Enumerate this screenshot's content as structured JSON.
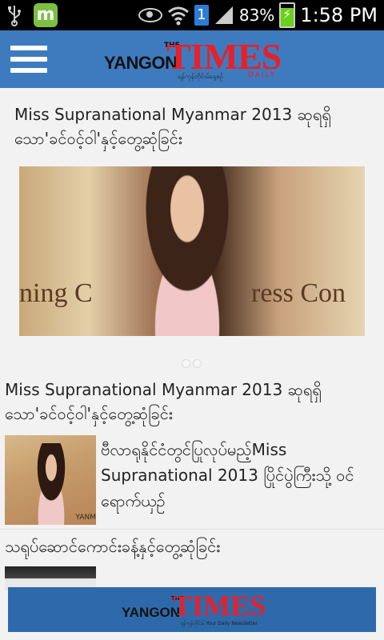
{
  "status_bar": {
    "battery_percent": "83%",
    "time": "1:58 PM",
    "notification_badge": "1",
    "app_icon_letter": "m",
    "icons": [
      "usb-icon",
      "m-app-icon",
      "eye-icon",
      "wifi-icon",
      "sim-badge-icon",
      "signal-icon",
      "battery-charging-icon"
    ]
  },
  "app_bar": {
    "logo": {
      "yangon": "YANGON",
      "the": "THE",
      "times": "TIMES",
      "subtitle": "ရန်ကုန်တိုင်းမ်နေ့စဉ်",
      "daily": "DAILY"
    },
    "menu_icon": "hamburger-menu-icon"
  },
  "featured": {
    "title": "Miss Supranational Myanmar 2013 ဆုရရှိသော'ခင်ဝင့်ဝါ'နှင့်တွေ့ဆုံခြင်း",
    "image_banner_left": "ning C",
    "image_banner_right": "ress Con",
    "page_indicator": {
      "count": 2,
      "active": 0
    }
  },
  "list": {
    "heading": "Miss Supranational Myanmar 2013 ဆုရရှိသော'ခင်ဝင့်ဝါ'နှင့်တွေ့ဆုံခြင်း",
    "items": [
      {
        "text": "ဗီလာရုနိုင်ငံတွင်ပြုလုပ်မည့်Miss Supranational 2013 ပြိုင်ပွဲကြီးသို့ ဝင်ရောက်ယှဉ်",
        "thumb_caption": "YANM"
      }
    ],
    "section2_title": "သရုပ်ဆောင်ကောင်းခန့်နှင့်တွေ့ဆုံခြင်း"
  },
  "ad_banner": {
    "yangon": "YANGON",
    "the": "THE",
    "times": "TIMES",
    "subtitle": "ရန်ကုန်တိုင်းမ် Your Daily Newsletter"
  },
  "colors": {
    "app_bar": "#3e7bbe",
    "times_red": "#e8202a",
    "status_bar": "#000000",
    "background": "#f2f2f2",
    "ad_banner": "#2e6aab"
  }
}
